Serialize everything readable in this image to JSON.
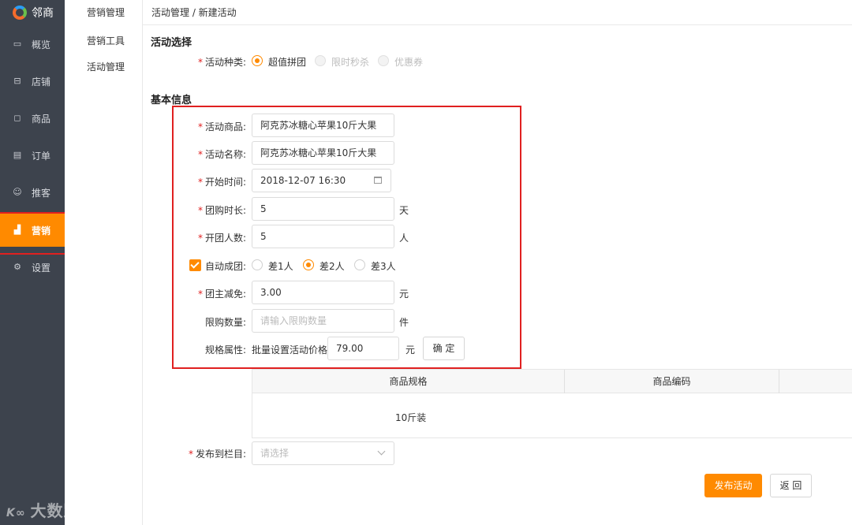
{
  "app": {
    "name": "邻商"
  },
  "sidebar": {
    "items": [
      {
        "label": "概览",
        "icon": "monitor-icon"
      },
      {
        "label": "店铺",
        "icon": "store-icon"
      },
      {
        "label": "商品",
        "icon": "bag-icon"
      },
      {
        "label": "订单",
        "icon": "document-icon"
      },
      {
        "label": "推客",
        "icon": "users-icon"
      },
      {
        "label": "营销",
        "icon": "chart-icon",
        "active": true
      },
      {
        "label": "设置",
        "icon": "gear-icon"
      }
    ]
  },
  "subnav": {
    "title": "营销管理",
    "items": [
      "营销工具",
      "活动管理"
    ]
  },
  "breadcrumb": "活动管理 / 新建活动",
  "activity_select": {
    "title": "活动选择",
    "label": "活动种类:",
    "options": [
      {
        "label": "超值拼团",
        "selected": true,
        "disabled": false
      },
      {
        "label": "限时秒杀",
        "selected": false,
        "disabled": true
      },
      {
        "label": "优惠券",
        "selected": false,
        "disabled": true
      }
    ]
  },
  "basic_info": {
    "title": "基本信息",
    "product": {
      "label": "活动商品:",
      "value": "阿克苏冰糖心苹果10斤大果"
    },
    "name": {
      "label": "活动名称:",
      "value": "阿克苏冰糖心苹果10斤大果"
    },
    "start_time": {
      "label": "开始时间:",
      "value": "2018-12-07 16:30"
    },
    "duration": {
      "label": "团购时长:",
      "value": "5",
      "unit": "天"
    },
    "group_size": {
      "label": "开团人数:",
      "value": "5",
      "unit": "人"
    },
    "auto_group": {
      "label": "自动成团:",
      "checked": true,
      "options": [
        {
          "label": "差1人",
          "selected": false
        },
        {
          "label": "差2人",
          "selected": true
        },
        {
          "label": "差3人",
          "selected": false
        }
      ]
    },
    "leader_discount": {
      "label": "团主减免:",
      "value": "3.00",
      "unit": "元"
    },
    "limit_qty": {
      "label": "限购数量:",
      "placeholder": "请输入限购数量",
      "unit": "件"
    },
    "spec": {
      "label": "规格属性:",
      "batch_label": "批量设置活动价格",
      "value": "79.00",
      "unit": "元",
      "confirm": "确 定"
    }
  },
  "spec_table": {
    "columns": [
      "商品规格",
      "商品编码"
    ],
    "rows": [
      [
        "10斤装",
        ""
      ]
    ]
  },
  "publish": {
    "label": "发布到栏目:",
    "placeholder": "请选择"
  },
  "actions": {
    "submit": "发布活动",
    "back": "返 回"
  },
  "watermark": "大数跨境"
}
